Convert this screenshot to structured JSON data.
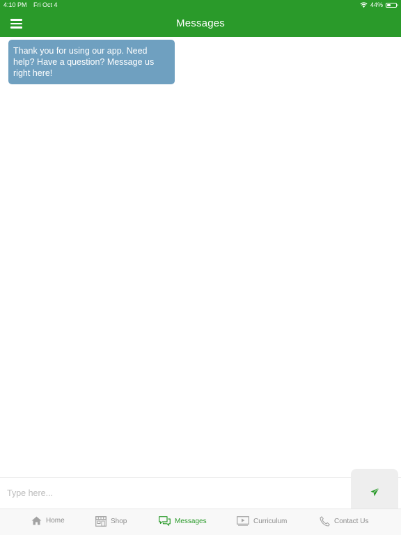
{
  "status_bar": {
    "time": "4:10 PM",
    "date": "Fri Oct 4",
    "battery": "44%",
    "battery_level": 0.44
  },
  "nav": {
    "title": "Messages"
  },
  "messages": [
    {
      "text": "Thank you for using our app. Need help? Have a question? Message us right here!"
    }
  ],
  "input": {
    "placeholder": "Type here..."
  },
  "tabs": [
    {
      "label": "Home",
      "icon": "home-icon",
      "active": false
    },
    {
      "label": "Shop",
      "icon": "shop-icon",
      "active": false
    },
    {
      "label": "Messages",
      "icon": "messages-icon",
      "active": true
    },
    {
      "label": "Curriculum",
      "icon": "video-icon",
      "active": false
    },
    {
      "label": "Contact Us",
      "icon": "phone-icon",
      "active": false
    }
  ],
  "colors": {
    "brand": "#2a9a2a",
    "bubble": "#6fa0c0",
    "inactive_tab": "#8c8c8c"
  }
}
